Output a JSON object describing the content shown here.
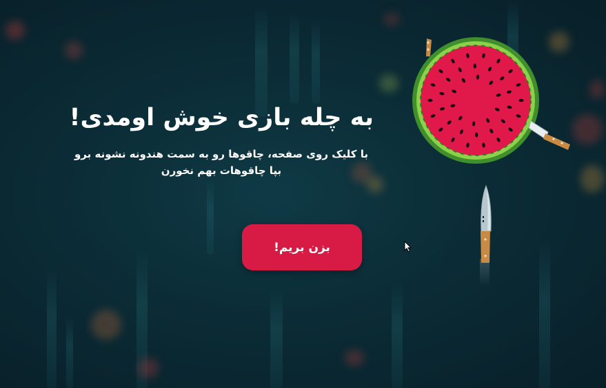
{
  "welcome": {
    "title": "به چله بازی خوش اومدی!",
    "instructions": "با کلیک روی صفحه، چاقوها رو به سمت هندونه نشونه برو بپا چاقوهات بهم نخورن"
  },
  "start_button": {
    "label": "بزن بریم!"
  },
  "colors": {
    "accent": "#d81b45",
    "background": "#0b2c36",
    "melon_flesh": "#e0194a",
    "melon_rind": "#7cc242"
  }
}
